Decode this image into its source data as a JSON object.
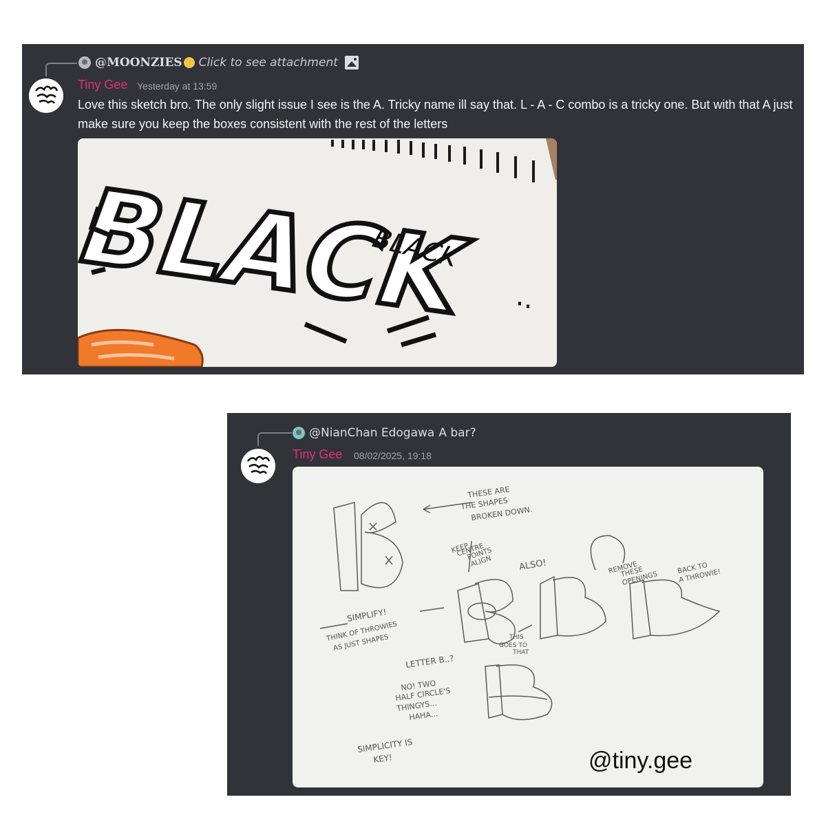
{
  "messages": [
    {
      "reply": {
        "mention": "@MOONZIES",
        "text": "Click to see attachment",
        "icon": "image-icon"
      },
      "author": "Tiny Gee",
      "timestamp": "Yesterday at 13:59",
      "text": "Love this sketch bro. The only slight issue I see is the A. Tricky name ill say that. L - A - C combo is a tricky one. But with that A just make sure you keep the boxes consistent with the rest of the letters",
      "attachment": {
        "graffiti_main": "BLACK",
        "graffiti_small": "BLACK"
      }
    },
    {
      "reply": {
        "mention": "@NianChan Edogawa",
        "text": "A bar?"
      },
      "author": "Tiny Gee",
      "timestamp": "08/02/2025, 19:18",
      "attachment": {
        "notes": {
          "shapes_broken": [
            "THESE ARE",
            "THE SHAPES",
            "BROKEN DOWN."
          ],
          "keep_centre": [
            "KEEP",
            "CENTRE",
            "POINTS",
            "ALIGN"
          ],
          "also": "ALSO!",
          "remove": [
            "REMOVE",
            "THESE",
            "OPENINGS",
            "BACK TO",
            "A THROWIE!"
          ],
          "simplify": [
            "SIMPLIFY!",
            "THINK OF THROWIES",
            "AS JUST SHAPES"
          ],
          "this_goes": [
            "THIS",
            "GOES TO",
            "THAT"
          ],
          "letter_b": "LETTER B..?",
          "no_two": [
            "NO! TWO",
            "HALF CIRCLE'S",
            "THINGYS...",
            "HAHA..."
          ],
          "simplicity": [
            "SIMPLICITY IS",
            "KEY!"
          ]
        },
        "watermark": "@tiny.gee"
      }
    }
  ],
  "colors": {
    "panel": "#313338",
    "username": "#e0307a",
    "text": "#f2f3f5",
    "timestamp": "#a3a6aa",
    "paper": "#f1f1ef",
    "orange": "#f07a2a"
  }
}
